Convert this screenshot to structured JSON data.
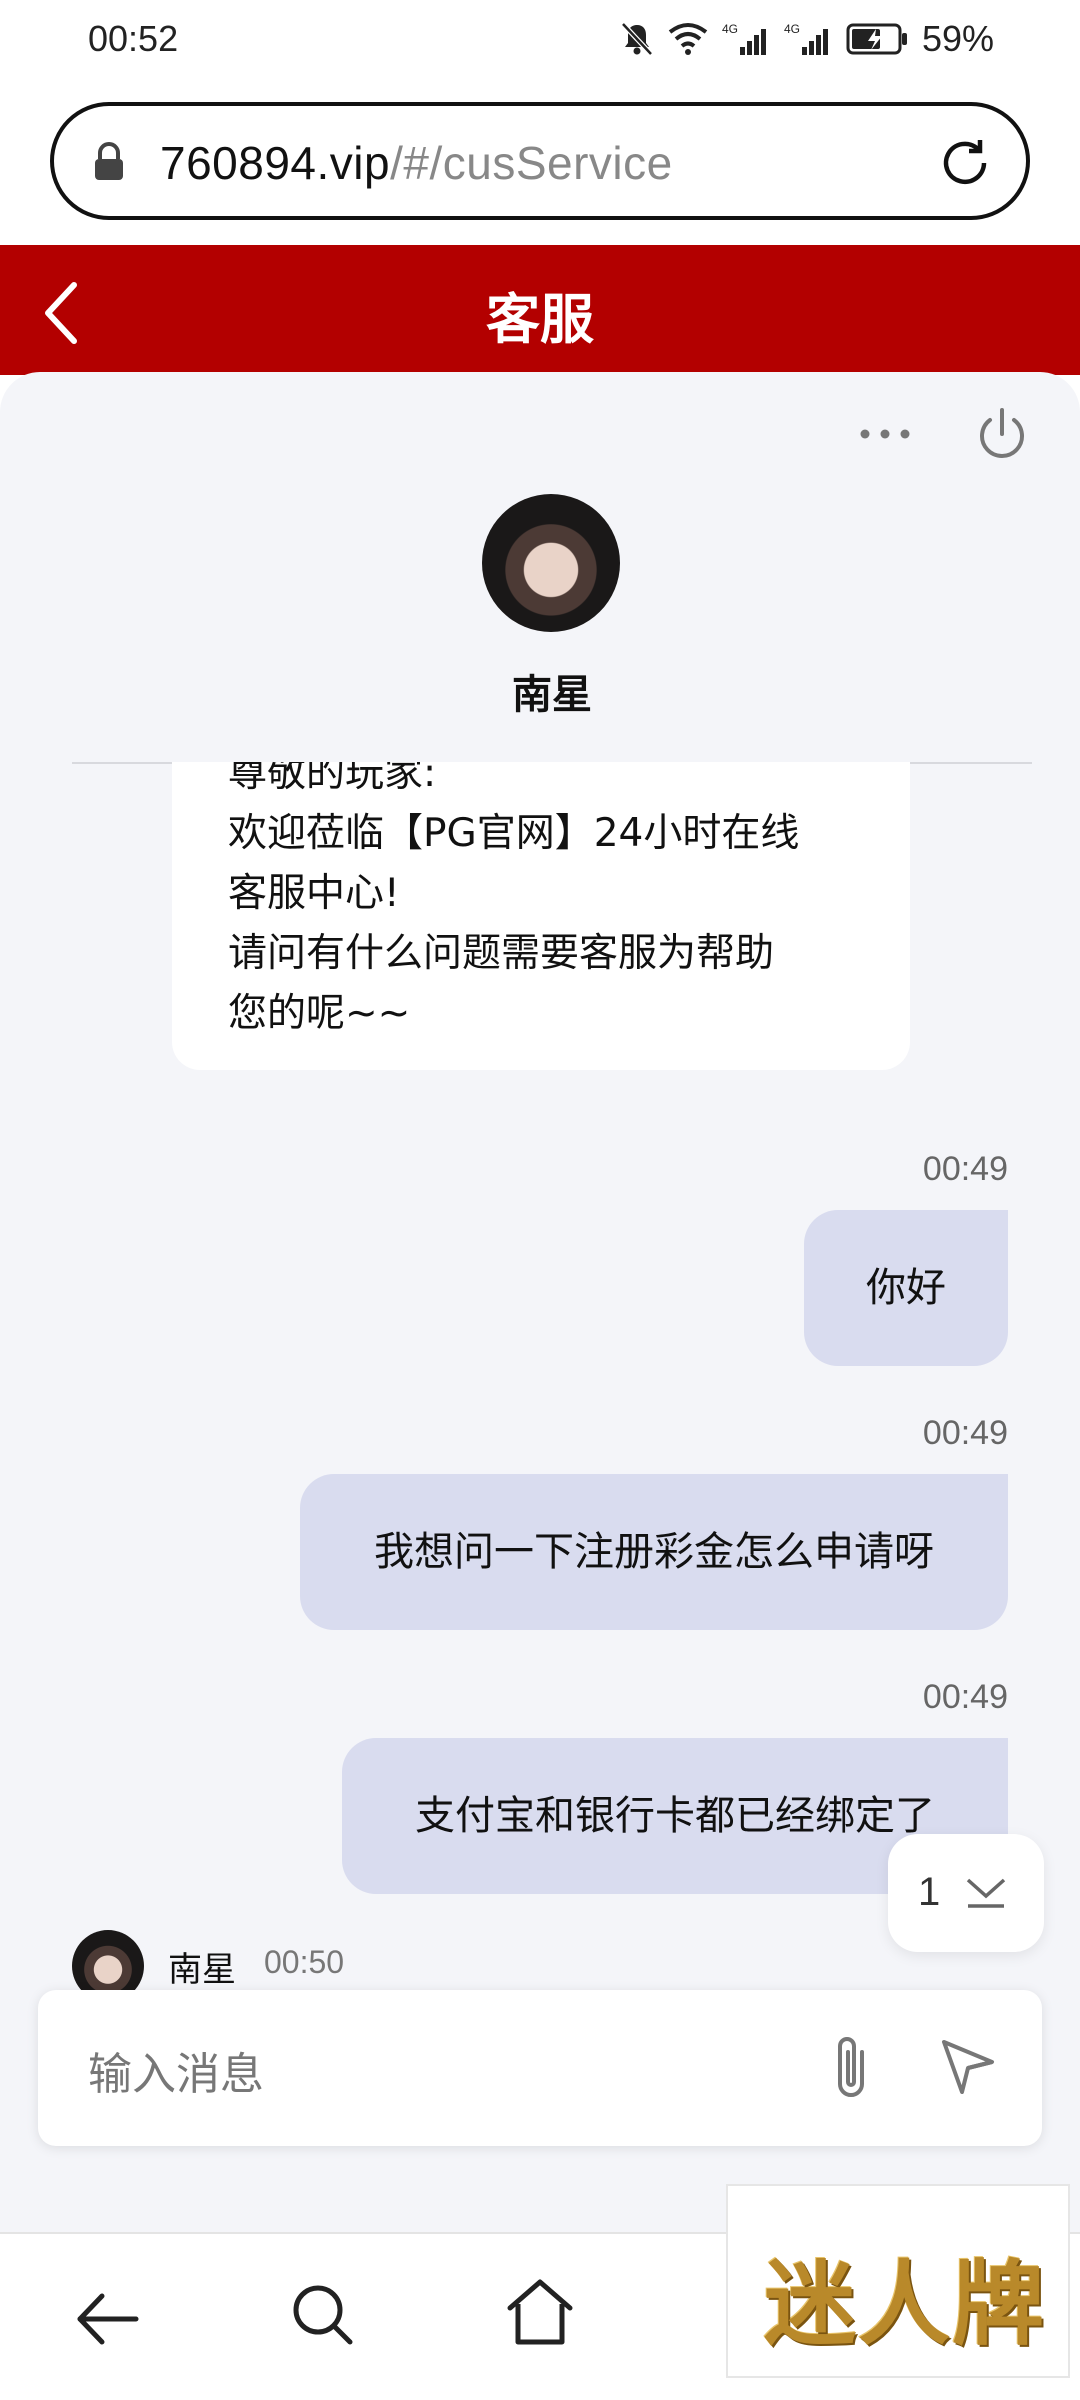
{
  "status_bar": {
    "time": "00:52",
    "battery_percent": "59%",
    "network_1": "4G",
    "network_2": "4G"
  },
  "browser": {
    "url_domain": "760894.vip",
    "url_path": "/#/cusService"
  },
  "header": {
    "title": "客服"
  },
  "agent": {
    "name": "南星"
  },
  "messages": {
    "agent_welcome": [
      "尊敬的玩家:",
      "欢迎莅临【PG官网】24小时在线",
      "客服中心!",
      "请问有什么问题需要客服为帮助",
      "您的呢~~"
    ],
    "user": [
      {
        "time": "00:49",
        "text": "你好"
      },
      {
        "time": "00:49",
        "text": "我想问一下注册彩金怎么申请呀"
      },
      {
        "time": "00:49",
        "text": "支付宝和银行卡都已经绑定了"
      }
    ],
    "agent_reply_time": "00:50"
  },
  "scroll_badge": {
    "count": "1"
  },
  "composer": {
    "placeholder": "输入消息"
  },
  "watermark": {
    "text": "迷人牌"
  },
  "colors": {
    "header_red": "#b30000",
    "user_bubble": "#d9dcef",
    "chat_bg": "#f4f5f9"
  }
}
